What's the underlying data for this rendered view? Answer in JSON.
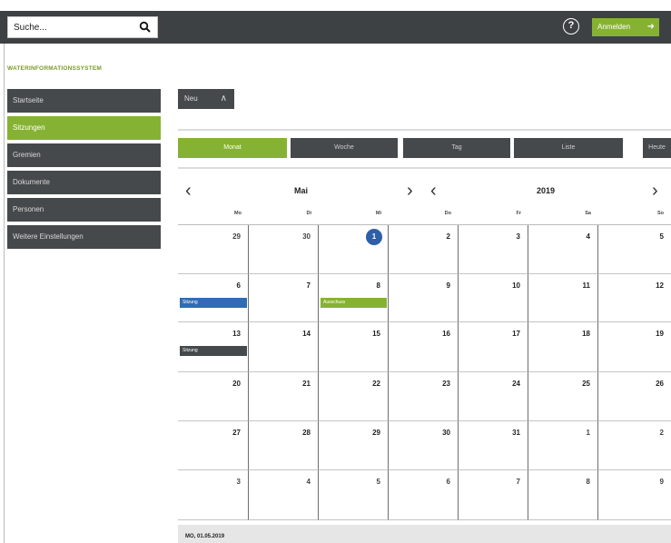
{
  "topbar": {
    "search_placeholder": "Suche...",
    "help_symbol": "?",
    "login_label": "Anmelden",
    "login_arrow": "➜"
  },
  "app": {
    "title": "WATERINFORMATIONSSYSTEM"
  },
  "sidebar": {
    "items": [
      {
        "label": "Startseite",
        "active": false
      },
      {
        "label": "Sitzungen",
        "active": true
      },
      {
        "label": "Gremien",
        "active": false
      },
      {
        "label": "Dokumente",
        "active": false
      },
      {
        "label": "Personen",
        "active": false
      },
      {
        "label": "Weitere Einstellungen",
        "active": false
      }
    ]
  },
  "toolbar": {
    "new_label": "Neu",
    "new_chevron": "∧"
  },
  "views": {
    "tabs": [
      {
        "label": "Monat",
        "active": true
      },
      {
        "label": "Woche",
        "active": false
      },
      {
        "label": "Tag",
        "active": false
      },
      {
        "label": "Liste",
        "active": false
      },
      {
        "label": "Heute",
        "active": false
      }
    ]
  },
  "calendar": {
    "month": "Mai",
    "year": "2019",
    "prev_symbol": "‹",
    "next_symbol": "›",
    "weekdays": [
      "Mo",
      "Di",
      "Mi",
      "Do",
      "Fr",
      "Sa",
      "So"
    ],
    "weeks": [
      [
        {
          "d": "29",
          "other": true
        },
        {
          "d": "30",
          "other": true
        },
        {
          "d": "1",
          "today": true
        },
        {
          "d": "2"
        },
        {
          "d": "3"
        },
        {
          "d": "4"
        },
        {
          "d": "5"
        }
      ],
      [
        {
          "d": "6"
        },
        {
          "d": "7"
        },
        {
          "d": "8"
        },
        {
          "d": "9"
        },
        {
          "d": "10"
        },
        {
          "d": "11"
        },
        {
          "d": "12"
        }
      ],
      [
        {
          "d": "13"
        },
        {
          "d": "14"
        },
        {
          "d": "15"
        },
        {
          "d": "16"
        },
        {
          "d": "17"
        },
        {
          "d": "18"
        },
        {
          "d": "19"
        }
      ],
      [
        {
          "d": "20"
        },
        {
          "d": "21"
        },
        {
          "d": "22"
        },
        {
          "d": "23"
        },
        {
          "d": "24"
        },
        {
          "d": "25"
        },
        {
          "d": "26"
        }
      ],
      [
        {
          "d": "27"
        },
        {
          "d": "28"
        },
        {
          "d": "29"
        },
        {
          "d": "30"
        },
        {
          "d": "31"
        },
        {
          "d": "1",
          "other": true
        },
        {
          "d": "2",
          "other": true
        }
      ],
      [
        {
          "d": "3",
          "other": true
        },
        {
          "d": "4",
          "other": true
        },
        {
          "d": "5",
          "other": true
        },
        {
          "d": "6",
          "other": true
        },
        {
          "d": "7",
          "other": true
        },
        {
          "d": "8",
          "other": true
        },
        {
          "d": "9",
          "other": true
        }
      ]
    ],
    "events": [
      {
        "week": 1,
        "day": 0,
        "label": "Sitzung",
        "color": "#2e6db4"
      },
      {
        "week": 1,
        "day": 2,
        "label": "Ausschuss",
        "color": "#86b233"
      },
      {
        "week": 2,
        "day": 0,
        "label": "Sitzung",
        "color": "#45494b"
      }
    ]
  },
  "footer": {
    "date_label": "MO, 01.05.2019"
  },
  "colors": {
    "accent": "#86b233",
    "dark": "#3d4143",
    "today": "#2e5fa8"
  }
}
